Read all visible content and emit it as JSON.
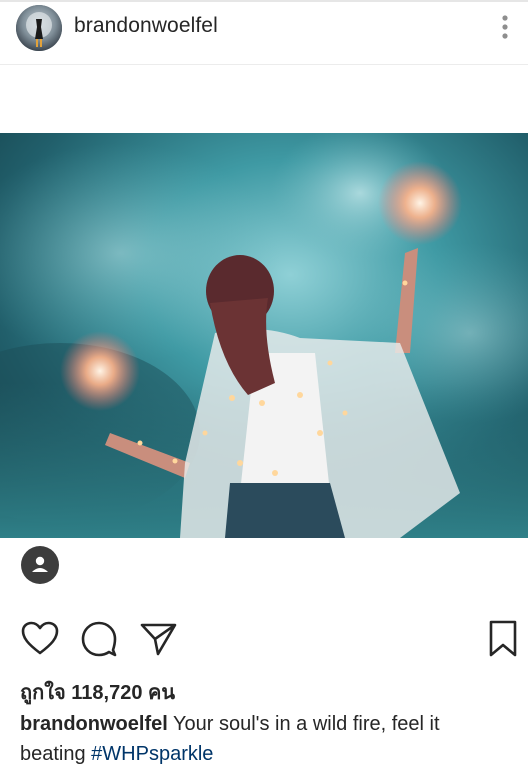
{
  "header": {
    "username": "brandonwoelfel",
    "avatar_icon": "profile-avatar",
    "more_icon": "more-vertical-icon"
  },
  "media": {
    "icon": "photo-sparkler-woman"
  },
  "tag_icon": "tagged-person-icon",
  "actions": {
    "like_icon": "heart-icon",
    "comment_icon": "comment-icon",
    "share_icon": "send-icon",
    "save_icon": "bookmark-icon"
  },
  "likes": {
    "label": "ถูกใจ 118,720 คน"
  },
  "caption": {
    "username": "brandonwoelfel",
    "text": " Your soul's in a wild fire, feel it beating ",
    "hashtag": "#WHPsparkle"
  },
  "colors": {
    "hashtag": "#003569",
    "text": "#262626",
    "divider": "#ececec"
  }
}
